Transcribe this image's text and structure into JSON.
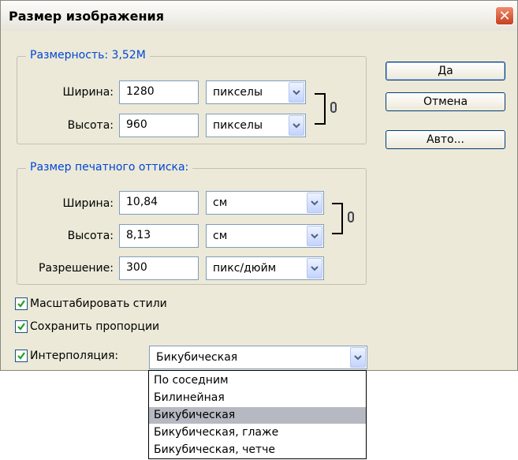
{
  "window": {
    "title": "Размер изображения"
  },
  "dimensions": {
    "legend_label": "Размерность:",
    "legend_value": "3,52M",
    "width": {
      "label": "Ширина:",
      "value": "1280",
      "unit": "пикселы"
    },
    "height": {
      "label": "Высота:",
      "value": "960",
      "unit": "пикселы"
    }
  },
  "print_size": {
    "legend": "Размер печатного оттиска:",
    "width": {
      "label": "Ширина:",
      "value": "10,84",
      "unit": "см"
    },
    "height": {
      "label": "Высота:",
      "value": "8,13",
      "unit": "см"
    },
    "resolution": {
      "label": "Разрешение:",
      "value": "300",
      "unit": "пикс/дюйм"
    }
  },
  "buttons": {
    "ok": "Да",
    "cancel": "Отмена",
    "auto": "Авто..."
  },
  "options": {
    "scale_styles": {
      "label": "Масштабировать стили",
      "checked": true
    },
    "constrain": {
      "label": "Сохранить пропорции",
      "checked": true
    },
    "interpolation": {
      "label": "Интерполяция:",
      "checked": true,
      "value": "Бикубическая"
    }
  },
  "interpolation_list": {
    "items": [
      "По соседним",
      "Билинейная",
      "Бикубическая",
      "Бикубическая, глаже",
      "Бикубическая, четче"
    ],
    "selected_index": 2
  },
  "colors": {
    "legend": "#0046d5",
    "dialog_bg": "#ece9d8",
    "selection": "#b6b8c2"
  },
  "icons": {
    "close": "close-icon",
    "chain": "chain-link-icon",
    "dropdown": "chevron-down-icon",
    "check": "checkmark-icon"
  }
}
